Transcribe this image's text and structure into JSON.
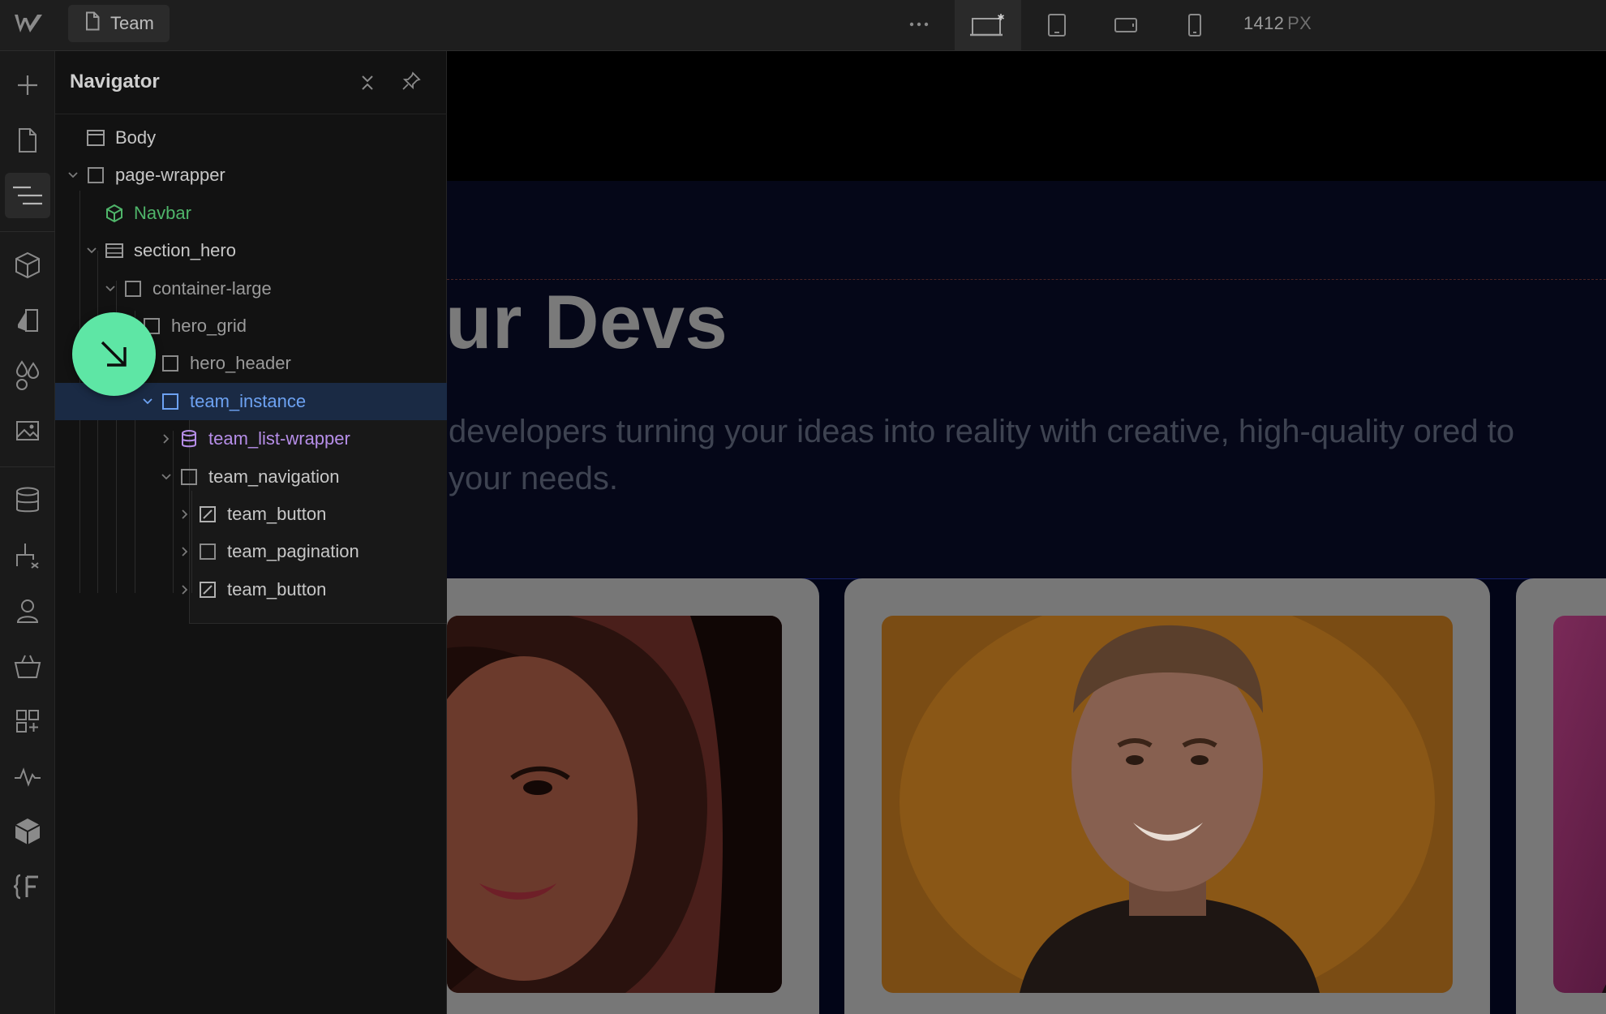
{
  "topbar": {
    "page_name": "Team",
    "breakpoint_width_value": "1412",
    "breakpoint_width_unit": "PX",
    "icons": {
      "logo": "webflow-logo",
      "page": "page-icon",
      "more": "more-horizontal-icon",
      "desktop": "desktop-base-breakpoint-icon",
      "tablet": "tablet-icon",
      "mobile_landscape": "mobile-landscape-icon",
      "mobile_portrait": "mobile-portrait-icon"
    }
  },
  "rail": {
    "items": [
      {
        "icon": "add-icon"
      },
      {
        "icon": "pages-icon"
      },
      {
        "icon": "navigator-icon",
        "active": true
      },
      {
        "icon": "components-icon"
      },
      {
        "icon": "style-selectors-icon"
      },
      {
        "icon": "variables-icon"
      },
      {
        "icon": "assets-icon"
      },
      {
        "icon": "cms-icon"
      },
      {
        "icon": "logic-icon"
      },
      {
        "icon": "users-icon"
      },
      {
        "icon": "ecommerce-icon"
      },
      {
        "icon": "apps-icon"
      },
      {
        "icon": "audit-icon"
      },
      {
        "icon": "libraries-icon"
      },
      {
        "icon": "finsweet-icon"
      }
    ]
  },
  "navigator": {
    "title": "Navigator",
    "tree": [
      {
        "label": "Body",
        "icon": "body-icon",
        "expand": "none",
        "type": "normal"
      },
      {
        "label": "page-wrapper",
        "icon": "box-icon",
        "expand": "open",
        "type": "normal"
      },
      {
        "label": "Navbar",
        "icon": "component-icon",
        "expand": "none",
        "type": "component"
      },
      {
        "label": "section_hero",
        "icon": "section-icon",
        "expand": "open",
        "type": "normal"
      },
      {
        "label": "container-large",
        "icon": "box-icon",
        "expand": "open",
        "type": "dim"
      },
      {
        "label": "hero_grid",
        "icon": "box-icon",
        "expand": "open",
        "type": "dim"
      },
      {
        "label": "hero_header",
        "icon": "box-icon",
        "expand": "none",
        "type": "dim"
      },
      {
        "label": "team_instance",
        "icon": "box-icon",
        "expand": "open",
        "type": "selected"
      },
      {
        "label": "team_list-wrapper",
        "icon": "collection-icon",
        "expand": "closed",
        "type": "collection"
      },
      {
        "label": "team_navigation",
        "icon": "box-icon",
        "expand": "open",
        "type": "normal"
      },
      {
        "label": "team_button",
        "icon": "link-block-icon",
        "expand": "closed",
        "type": "normal"
      },
      {
        "label": "team_pagination",
        "icon": "box-icon",
        "expand": "closed",
        "type": "normal"
      },
      {
        "label": "team_button",
        "icon": "link-block-icon",
        "expand": "closed",
        "type": "normal"
      }
    ]
  },
  "canvas": {
    "hero_title": "ur Devs",
    "hero_subtitle": "developers turning your ideas into reality with creative, high-quality ored to your needs.",
    "cards": [
      {
        "photo": "woman-portrait"
      },
      {
        "photo": "man-portrait"
      },
      {
        "photo": "pink-gradient"
      }
    ]
  },
  "cursor": {
    "icon": "arrow-down-right-icon"
  },
  "colors": {
    "accent_blue": "#6da2f2",
    "component_green": "#4fb56a",
    "collection_purple": "#b68ee8",
    "cursor_green": "#5ee6a5"
  }
}
